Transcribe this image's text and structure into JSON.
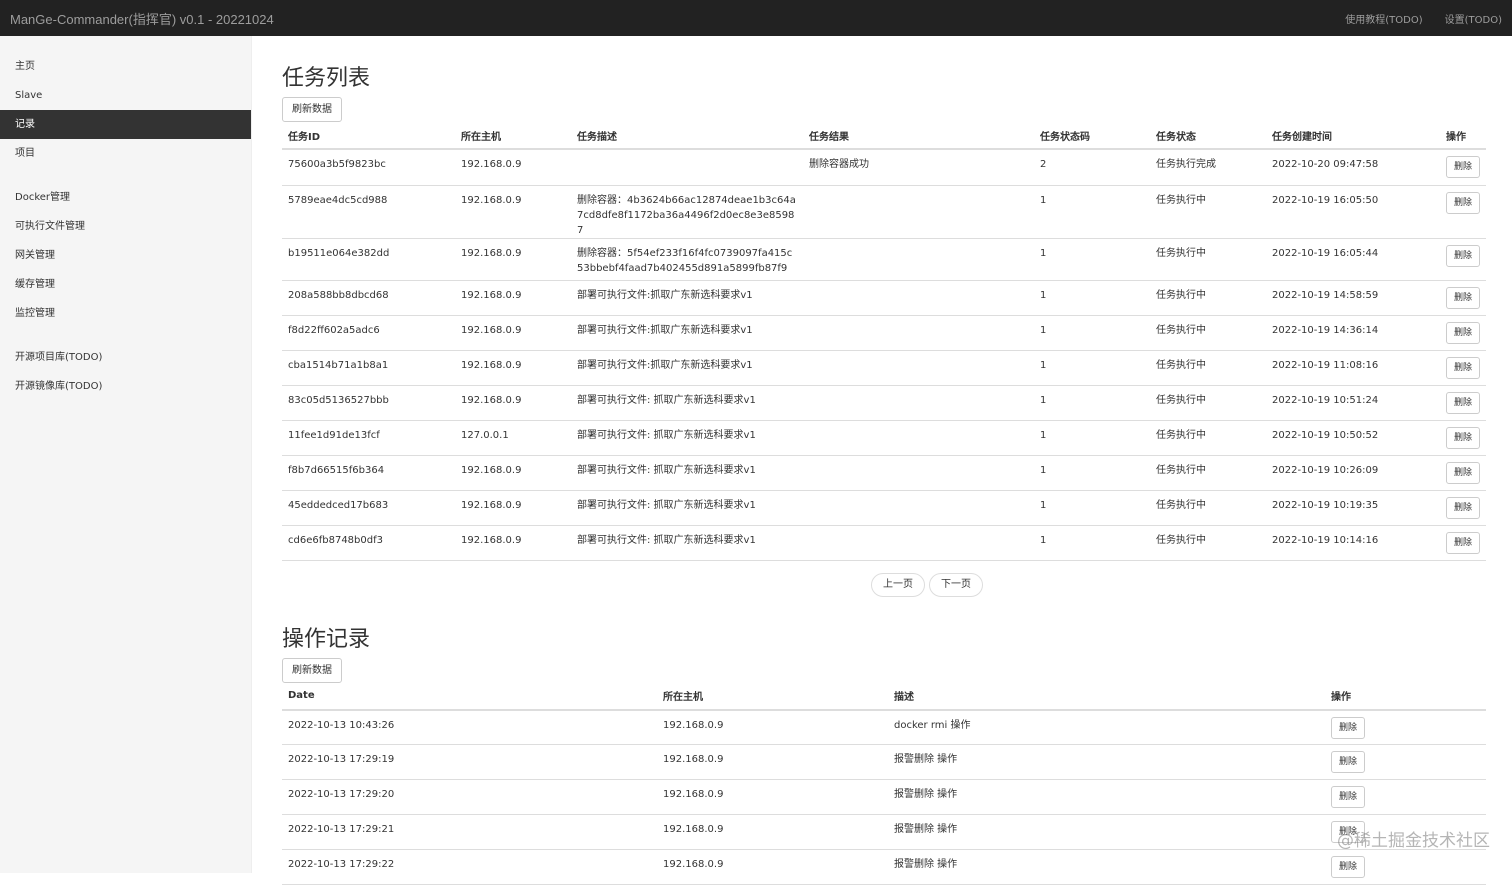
{
  "header": {
    "title": "ManGe-Commander(指挥官) v0.1 - 20221024",
    "links": [
      "使用教程(TODO)",
      "设置(TODO)"
    ]
  },
  "sidebar": {
    "items": [
      "主页",
      "Slave",
      "记录",
      "项目",
      "Docker管理",
      "可执行文件管理",
      "网关管理",
      "缓存管理",
      "监控管理",
      "开源项目库(TODO)",
      "开源镜像库(TODO)"
    ],
    "active": "记录"
  },
  "tasks": {
    "title": "任务列表",
    "refresh_label": "刷新数据",
    "columns": [
      "任务ID",
      "所在主机",
      "任务描述",
      "任务结果",
      "任务状态码",
      "任务状态",
      "任务创建时间",
      "操作"
    ],
    "rows": [
      [
        "75600a3b5f9823bc",
        "192.168.0.9",
        "",
        "删除容器成功",
        "2",
        "任务执行完成",
        "2022-10-20 09:47:58"
      ],
      [
        "5789eae4dc5cd988",
        "192.168.0.9",
        "删除容器：4b3624b66ac12874deae1b3c64a7cd8dfe8f1172ba36a4496f2d0ec8e3e85987",
        "",
        "1",
        "任务执行中",
        "2022-10-19 16:05:50"
      ],
      [
        "b19511e064e382dd",
        "192.168.0.9",
        "删除容器：5f54ef233f16f4fc0739097fa415c53bbebf4faad7b402455d891a5899fb87f9",
        "",
        "1",
        "任务执行中",
        "2022-10-19 16:05:44"
      ],
      [
        "208a588bb8dbcd68",
        "192.168.0.9",
        "部署可执行文件:抓取广东新选科要求v1",
        "",
        "1",
        "任务执行中",
        "2022-10-19 14:58:59"
      ],
      [
        "f8d22ff602a5adc6",
        "192.168.0.9",
        "部署可执行文件:抓取广东新选科要求v1",
        "",
        "1",
        "任务执行中",
        "2022-10-19 14:36:14"
      ],
      [
        "cba1514b71a1b8a1",
        "192.168.0.9",
        "部署可执行文件:抓取广东新选科要求v1",
        "",
        "1",
        "任务执行中",
        "2022-10-19 11:08:16"
      ],
      [
        "83c05d5136527bbb",
        "192.168.0.9",
        "部署可执行文件: 抓取广东新选科要求v1",
        "",
        "1",
        "任务执行中",
        "2022-10-19 10:51:24"
      ],
      [
        "11fee1d91de13fcf",
        "127.0.0.1",
        "部署可执行文件: 抓取广东新选科要求v1",
        "",
        "1",
        "任务执行中",
        "2022-10-19 10:50:52"
      ],
      [
        "f8b7d66515f6b364",
        "192.168.0.9",
        "部署可执行文件: 抓取广东新选科要求v1",
        "",
        "1",
        "任务执行中",
        "2022-10-19 10:26:09"
      ],
      [
        "45eddedced17b683",
        "192.168.0.9",
        "部署可执行文件: 抓取广东新选科要求v1",
        "",
        "1",
        "任务执行中",
        "2022-10-19 10:19:35"
      ],
      [
        "cd6e6fb8748b0df3",
        "192.168.0.9",
        "部署可执行文件: 抓取广东新选科要求v1",
        "",
        "1",
        "任务执行中",
        "2022-10-19 10:14:16"
      ]
    ],
    "delete_label": "删除",
    "prev_label": "上一页",
    "next_label": "下一页"
  },
  "ops": {
    "title": "操作记录",
    "refresh_label": "刷新数据",
    "columns": [
      "Date",
      "所在主机",
      "描述",
      "操作"
    ],
    "rows": [
      [
        "2022-10-13 10:43:26",
        "192.168.0.9",
        "docker rmi 操作"
      ],
      [
        "2022-10-13 17:29:19",
        "192.168.0.9",
        "报警删除 操作"
      ],
      [
        "2022-10-13 17:29:20",
        "192.168.0.9",
        "报警删除 操作"
      ],
      [
        "2022-10-13 17:29:21",
        "192.168.0.9",
        "报警删除 操作"
      ],
      [
        "2022-10-13 17:29:22",
        "192.168.0.9",
        "报警删除 操作"
      ]
    ],
    "delete_label": "删除"
  },
  "watermark": "@稀土掘金技术社区"
}
